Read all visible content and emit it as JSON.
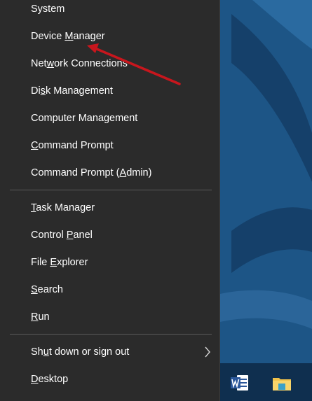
{
  "menu": {
    "items": [
      {
        "id": "system",
        "label": "System"
      },
      {
        "id": "device-manager",
        "label": "Device Manager"
      },
      {
        "id": "network-connections",
        "label": "Network Connections"
      },
      {
        "id": "disk-management",
        "label": "Disk Management"
      },
      {
        "id": "computer-management",
        "label": "Computer Management"
      },
      {
        "id": "command-prompt",
        "label": "Command Prompt"
      },
      {
        "id": "command-prompt-admin",
        "label": "Command Prompt (Admin)"
      },
      {
        "id": "task-manager",
        "label": "Task Manager"
      },
      {
        "id": "control-panel",
        "label": "Control Panel"
      },
      {
        "id": "file-explorer",
        "label": "File Explorer"
      },
      {
        "id": "search",
        "label": "Search"
      },
      {
        "id": "run",
        "label": "Run"
      },
      {
        "id": "shut-down",
        "label": "Shut down or sign out"
      },
      {
        "id": "desktop",
        "label": "Desktop"
      }
    ]
  },
  "colors": {
    "menu_bg": "#2b2b2b",
    "menu_text": "#ffffff",
    "separator": "#5a5a5a",
    "annotation_arrow": "#c8161d",
    "wallpaper": "#1b4f7c"
  },
  "icons": {
    "submenu": "chevron-right-icon",
    "word": "word-icon",
    "explorer": "file-explorer-icon"
  }
}
